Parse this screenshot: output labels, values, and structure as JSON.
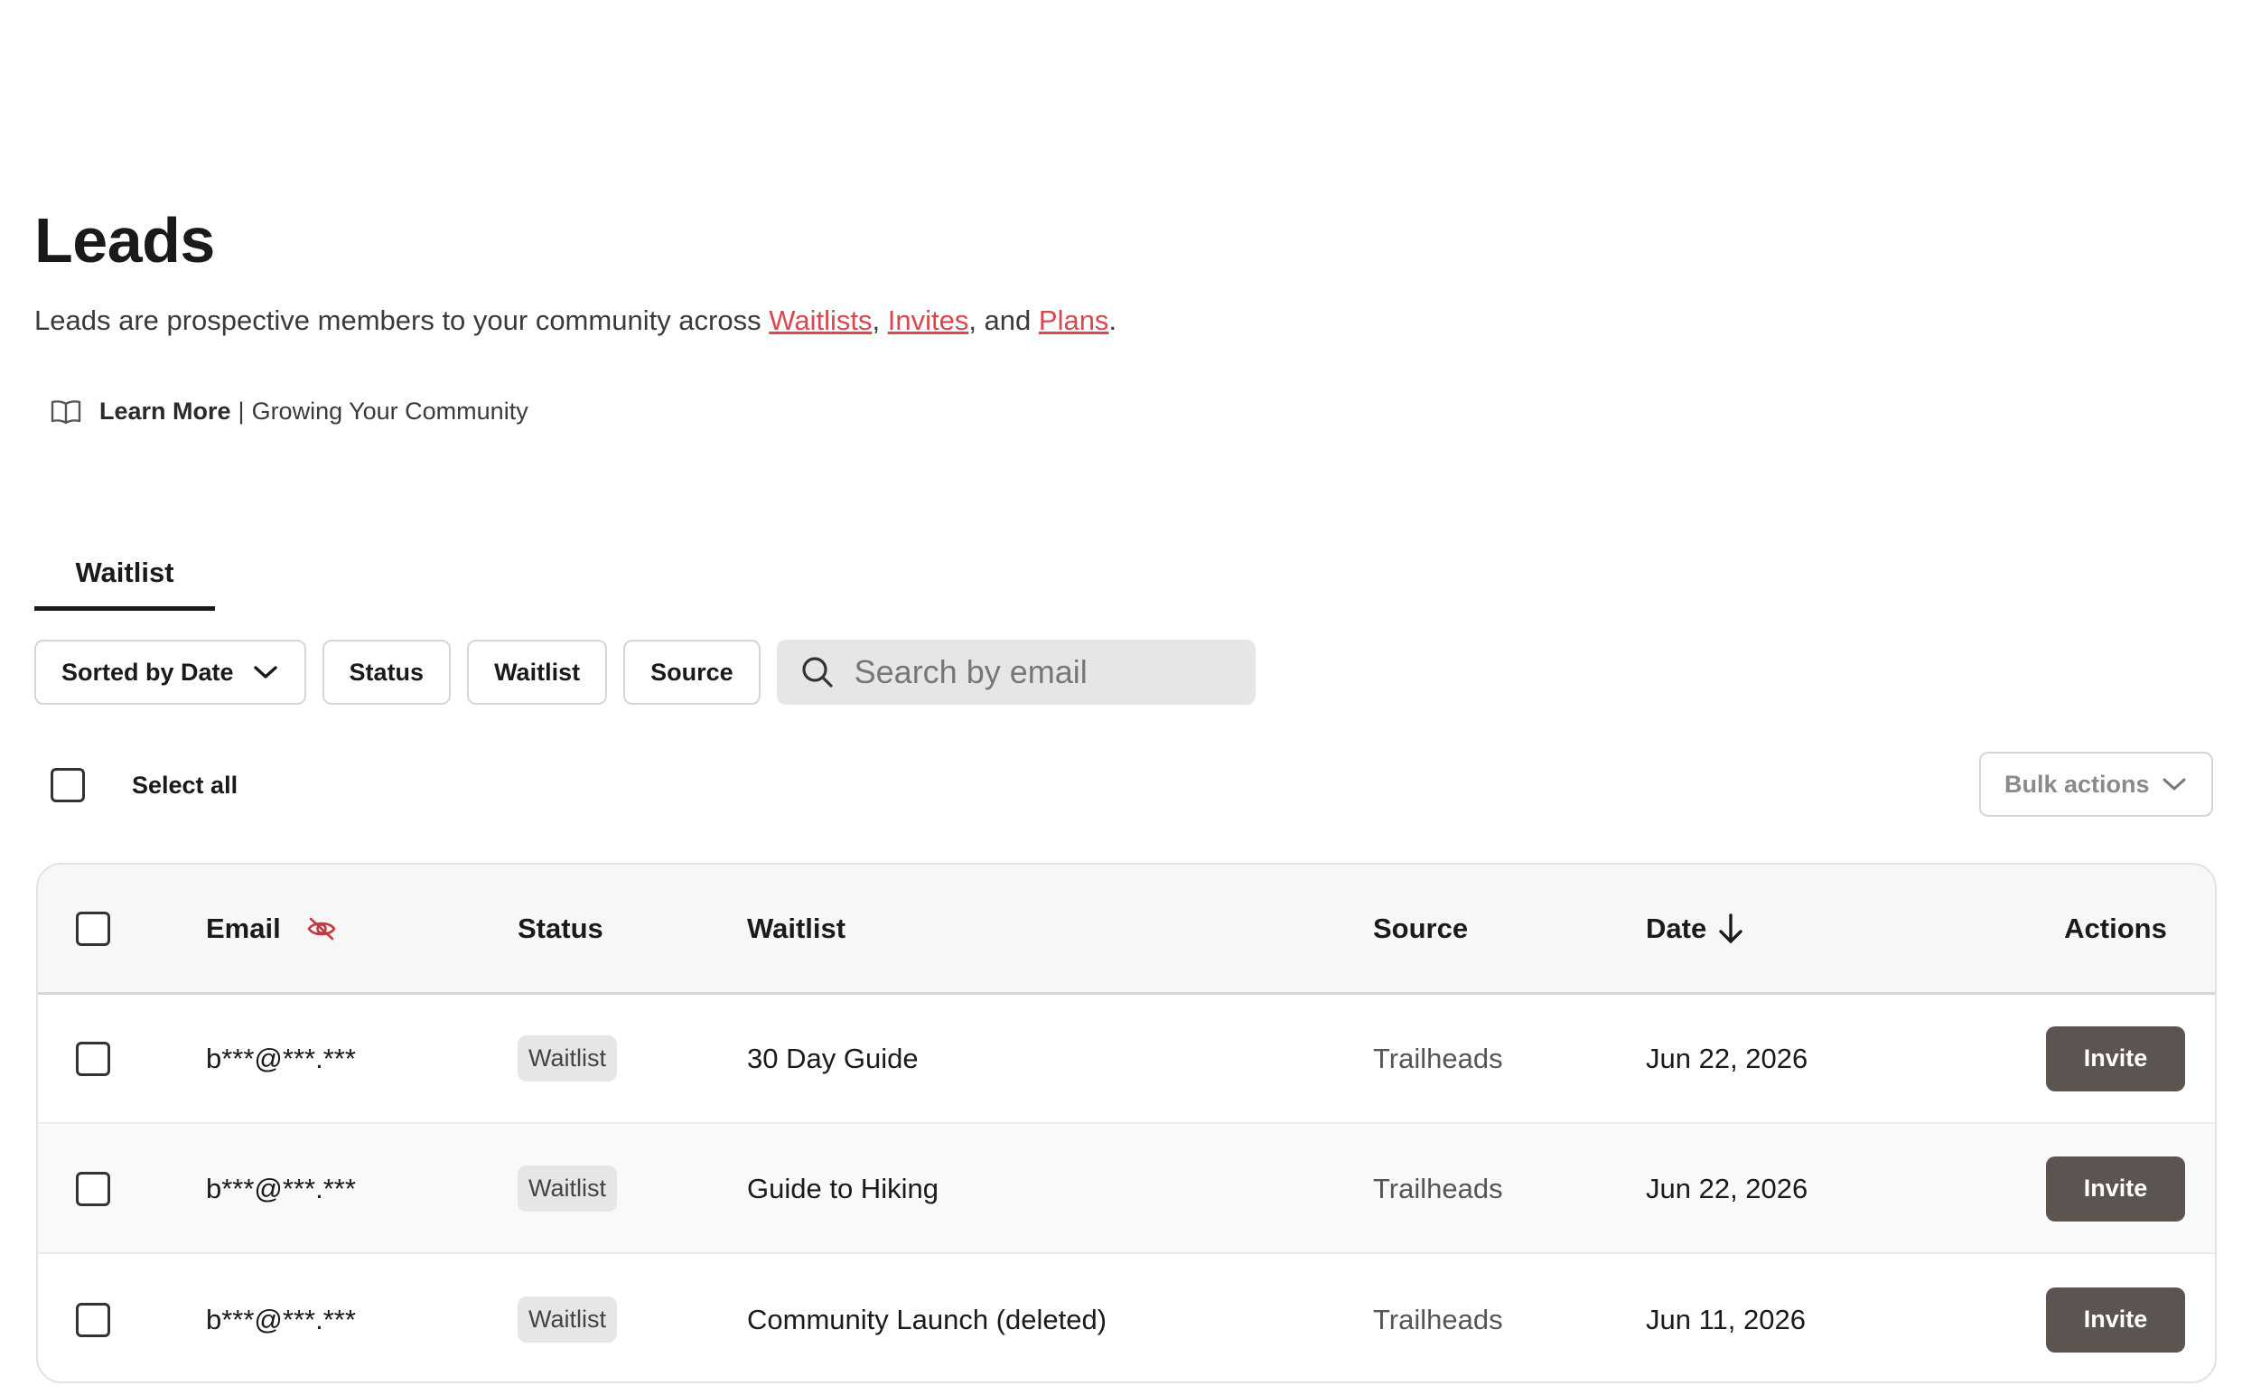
{
  "page": {
    "title": "Leads",
    "subtitle_prefix": "Leads are prospective members to your community across ",
    "link_waitlists": "Waitlists",
    "comma1": ", ",
    "link_invites": "Invites",
    "and_text": ", and ",
    "link_plans": "Plans",
    "period": "."
  },
  "learn_more": {
    "label": "Learn More",
    "separator": "|",
    "topic": "Growing Your Community",
    "icon": "book-icon"
  },
  "tabs": [
    {
      "label": "Waitlist",
      "active": true
    }
  ],
  "filters": {
    "sort_label": "Sorted by Date",
    "status_label": "Status",
    "waitlist_label": "Waitlist",
    "source_label": "Source",
    "search_placeholder": "Search by email"
  },
  "select_all_label": "Select all",
  "bulk_actions_label": "Bulk actions",
  "table": {
    "headers": {
      "email": "Email",
      "status": "Status",
      "waitlist": "Waitlist",
      "source": "Source",
      "date": "Date",
      "actions": "Actions"
    },
    "rows": [
      {
        "email": "b***@***.***",
        "status": "Waitlist",
        "waitlist": "30 Day Guide",
        "source": "Trailheads",
        "date": "Jun 22, 2026",
        "action": "Invite"
      },
      {
        "email": "b***@***.***",
        "status": "Waitlist",
        "waitlist": "Guide to Hiking",
        "source": "Trailheads",
        "date": "Jun 22, 2026",
        "action": "Invite"
      },
      {
        "email": "b***@***.***",
        "status": "Waitlist",
        "waitlist": "Community Launch (deleted)",
        "source": "Trailheads",
        "date": "Jun 11, 2026",
        "action": "Invite"
      }
    ]
  },
  "colors": {
    "link": "#d9474f",
    "invite_button": "#5c5450",
    "badge_bg": "#e6e6e6"
  }
}
